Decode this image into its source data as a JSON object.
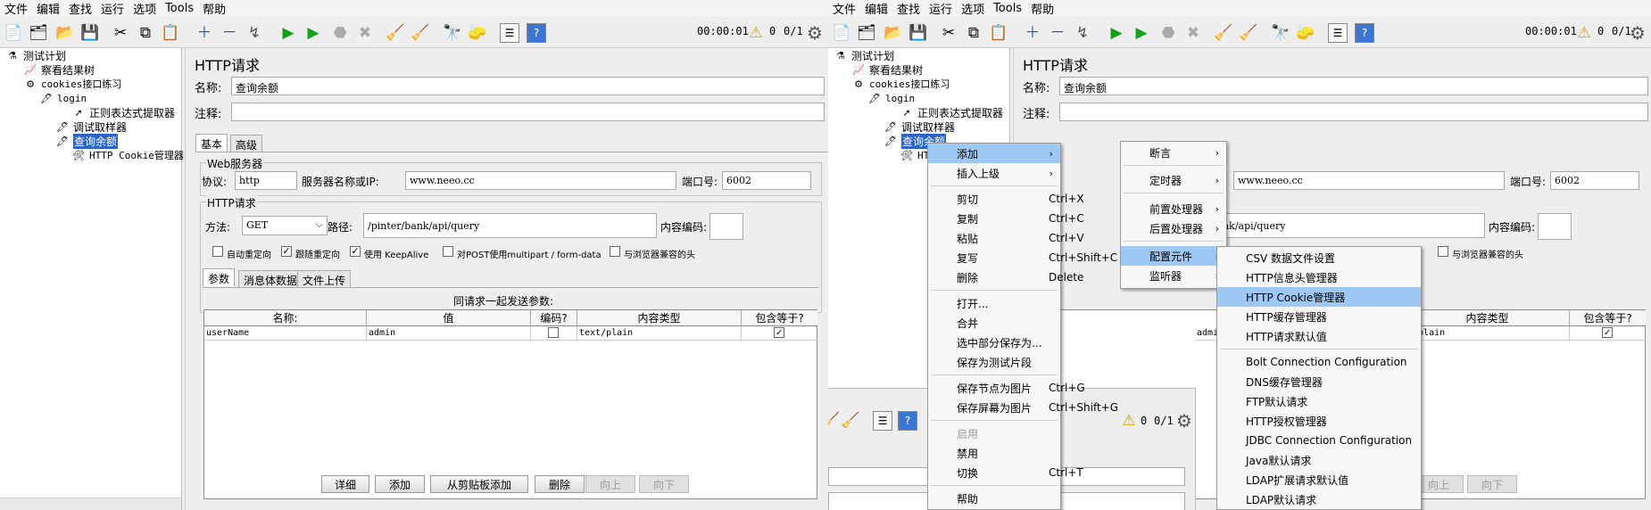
{
  "menubar": [
    "文件",
    "编辑",
    "查找",
    "运行",
    "选项",
    "Tools",
    "帮助"
  ],
  "toolbar": {
    "timer": "00:00:01",
    "warn_count": "0",
    "ratio": "0/1"
  },
  "tree": {
    "test_plan": "测试计划",
    "view_results": "察看结果树",
    "thread_group": "cookies接口练习",
    "login": "login",
    "regex": "正则表达式提取器",
    "debug": "调试取样器",
    "query": "查询余额",
    "cookie_mgr": "HTTP Cookie管理器"
  },
  "panel": {
    "title": "HTTP请求",
    "name_label": "名称:",
    "name_value": "查询余额",
    "comment_label": "注释:",
    "tab_basic": "基本",
    "tab_advanced": "高级",
    "web_server": "Web服务器",
    "protocol_label": "协议:",
    "protocol_value": "http",
    "server_label": "服务器名称或IP:",
    "server_value": "www.neeo.cc",
    "port_label": "端口号:",
    "port_value": "6002",
    "http_request": "HTTP请求",
    "method_label": "方法:",
    "method_value": "GET",
    "path_label": "路径:",
    "path_value": "/pinter/bank/api/query",
    "encoding_label": "内容编码:",
    "cb_redirect": "自动重定向",
    "cb_follow": "跟随重定向",
    "cb_keepalive": "使用 KeepAlive",
    "cb_multipart": "对POST使用multipart / form-data",
    "cb_browser": "与浏览器兼容的头",
    "tab_params": "参数",
    "tab_body": "消息体数据",
    "tab_files": "文件上传",
    "params_title": "同请求一起发送参数:",
    "columns": [
      "名称:",
      "值",
      "编码?",
      "内容类型",
      "包含等于?"
    ],
    "row": {
      "name": "userName",
      "value": "admin",
      "type": "text/plain"
    },
    "buttons": [
      "详细",
      "添加",
      "从剪贴板添加",
      "删除",
      "向上",
      "向下"
    ]
  },
  "right_partial": {
    "server_value": "www.neeo.cc",
    "port_value": "6002",
    "path_value": "er/bank/api/query",
    "col_value_part": "admi",
    "type_part": "t/plain"
  },
  "context_menu": [
    {
      "label": "添加",
      "shortcut": ""
    },
    {
      "label": "插入上级",
      "shortcut": ""
    },
    {
      "label": "剪切",
      "shortcut": "Ctrl+X"
    },
    {
      "label": "复制",
      "shortcut": "Ctrl+C"
    },
    {
      "label": "粘贴",
      "shortcut": "Ctrl+V"
    },
    {
      "label": "复写",
      "shortcut": "Ctrl+Shift+C"
    },
    {
      "label": "删除",
      "shortcut": "Delete"
    },
    {
      "label": "打开...",
      "shortcut": ""
    },
    {
      "label": "合并",
      "shortcut": ""
    },
    {
      "label": "选中部分保存为...",
      "shortcut": ""
    },
    {
      "label": "保存为测试片段",
      "shortcut": ""
    },
    {
      "label": "保存节点为图片",
      "shortcut": "Ctrl+G"
    },
    {
      "label": "保存屏幕为图片",
      "shortcut": "Ctrl+Shift+G"
    },
    {
      "label": "启用",
      "shortcut": ""
    },
    {
      "label": "禁用",
      "shortcut": ""
    },
    {
      "label": "切换",
      "shortcut": "Ctrl+T"
    },
    {
      "label": "帮助",
      "shortcut": ""
    }
  ],
  "submenu_add": [
    "断言",
    "定时器",
    "前置处理器",
    "后置处理器",
    "配置元件",
    "监听器"
  ],
  "submenu_config": [
    "CSV 数据文件设置",
    "HTTP信息头管理器",
    "HTTP Cookie管理器",
    "HTTP缓存管理器",
    "HTTP请求默认值",
    "Bolt Connection Configuration",
    "DNS缓存管理器",
    "FTP默认请求",
    "HTTP授权管理器",
    "JDBC Connection Configuration",
    "Java默认请求",
    "LDAP扩展请求默认值",
    "LDAP默认请求"
  ],
  "colors": {
    "selection": "#2d63c7",
    "menu_highlight": "#9ec9f5"
  }
}
